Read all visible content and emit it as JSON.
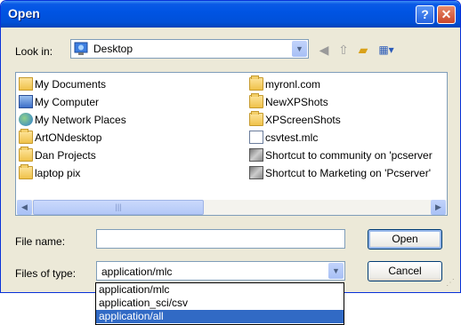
{
  "window": {
    "title": "Open"
  },
  "toolbar": {
    "look_in_label": "Look in:",
    "look_in_value": "Desktop"
  },
  "files": {
    "column1": [
      {
        "name": "My Documents",
        "icon": "my-documents-icon"
      },
      {
        "name": "My Computer",
        "icon": "my-computer-icon"
      },
      {
        "name": "My Network Places",
        "icon": "network-places-icon"
      },
      {
        "name": "ArtONdesktop",
        "icon": "folder-icon"
      },
      {
        "name": "Dan Projects",
        "icon": "folder-icon"
      },
      {
        "name": "laptop pix",
        "icon": "folder-icon"
      }
    ],
    "column2": [
      {
        "name": "myronl.com",
        "icon": "folder-icon"
      },
      {
        "name": "NewXPShots",
        "icon": "folder-icon"
      },
      {
        "name": "XPScreenShots",
        "icon": "folder-icon"
      },
      {
        "name": "csvtest.mlc",
        "icon": "document-icon"
      },
      {
        "name": "Shortcut to community on 'pcserver",
        "icon": "shortcut-icon"
      },
      {
        "name": "Shortcut to Marketing on 'Pcserver'",
        "icon": "shortcut-icon"
      }
    ]
  },
  "form": {
    "file_name_label": "File name:",
    "file_name_value": "",
    "files_of_type_label": "Files of type:",
    "files_of_type_value": "application/mlc"
  },
  "buttons": {
    "open": "Open",
    "cancel": "Cancel"
  },
  "dropdown": {
    "options": [
      "application/mlc",
      "application_sci/csv",
      "application/all"
    ],
    "selected_index": 2
  },
  "colors": {
    "titlebar": "#0054e3",
    "selection": "#316ac5",
    "dialog_bg": "#ece9d8"
  }
}
